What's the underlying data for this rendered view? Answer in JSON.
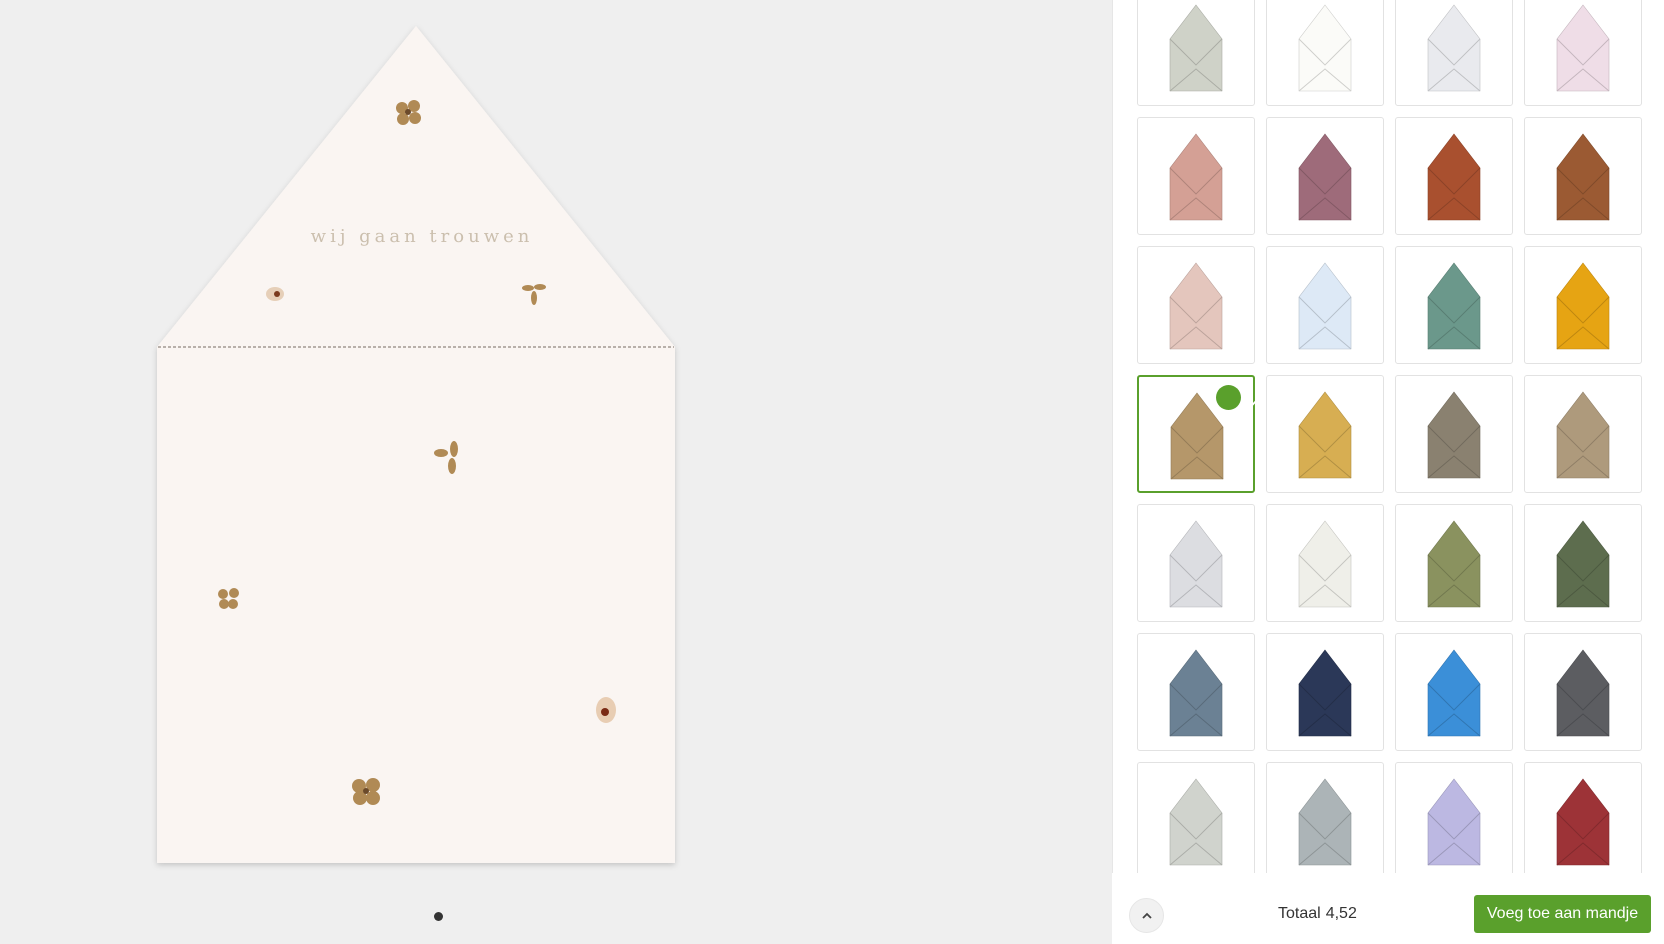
{
  "preview": {
    "card_text": "wij gaan trouwen"
  },
  "swatch_colors": [
    [
      "#cfd2c8",
      "#fbfbf8",
      "#e9eaee",
      "#efdde7"
    ],
    [
      "#d4a095",
      "#9e6b7a",
      "#a9502f",
      "#9b5a33"
    ],
    [
      "#e4c6bd",
      "#dde9f6",
      "#6b988b",
      "#e6a413"
    ],
    [
      "#b5976a",
      "#d7ae52",
      "#8a8170",
      "#ae9a7c"
    ],
    [
      "#dcdde1",
      "#efefe9",
      "#8a925f",
      "#5d6d4e"
    ],
    [
      "#6b8194",
      "#2b3858",
      "#3b8fd8",
      "#5c5d61"
    ],
    [
      "#d0d3cd",
      "#acb4b7",
      "#bcb8e2",
      "#9d3337"
    ]
  ],
  "selected": {
    "row": 3,
    "col": 0
  },
  "footer": {
    "total_label": "Totaal",
    "total_value": "4,52",
    "add_to_cart_label": "Voeg toe aan mandje"
  },
  "icons": {
    "check": "check-icon",
    "collapse": "chevron-up-icon"
  },
  "colors": {
    "accent": "#5aa02c",
    "card_paper": "#faf5f2"
  }
}
